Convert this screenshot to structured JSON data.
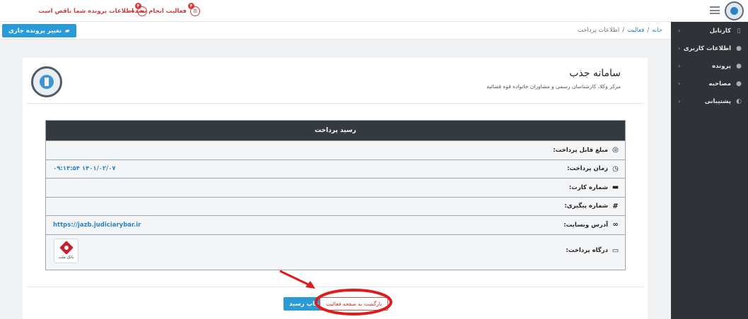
{
  "topbar": {
    "notifications": [
      {
        "label": "فعالیت انجام نشده",
        "badge": "۴",
        "icon": "list-icon"
      },
      {
        "label": "اطلاعات پرونده شما ناقص است",
        "badge": "۴",
        "icon": "folder-icon"
      }
    ],
    "first_notif_prefix": "",
    "brand_icon": "judiciary-emblem-icon"
  },
  "sidebar": {
    "items": [
      {
        "label": "کارتابل",
        "icon": "clipboard-icon"
      },
      {
        "label": "اطلاعات کاربری",
        "icon": "users-icon"
      },
      {
        "label": "پرونده",
        "icon": "user-icon"
      },
      {
        "label": "مصاحبه",
        "icon": "users-icon"
      },
      {
        "label": "پشتیبانی",
        "icon": "headset-icon"
      }
    ]
  },
  "breadcrumb": {
    "home": "خانه",
    "activity": "فعالیت",
    "current": "اطلاعات پرداخت",
    "sep": "/"
  },
  "actions": {
    "change_case": "تغییر پرونده جاری",
    "print_receipt": "چاپ رسید",
    "back_to_activity": "بازگشت به صفحه فعالیت"
  },
  "header": {
    "title": "سامانه جذب",
    "subtitle": "مرکز وکلا، کارشناسان رسمی و مشاوران خانواده قوه قضائیه"
  },
  "receipt": {
    "title": "رسید پرداخت",
    "rows": [
      {
        "label": "مبلغ قابل پرداخت:",
        "value": "",
        "icon": "check-circle-icon"
      },
      {
        "label": "زمان پرداخت:",
        "value": "۰۹:۱۴:۵۴ ۱۴۰۱/۰۲/۰۷",
        "icon": "clock-icon"
      },
      {
        "label": "شماره کارت:",
        "value": "",
        "icon": "credit-card-icon"
      },
      {
        "label": "شماره پیگیری:",
        "value": "",
        "icon": "hash-icon"
      },
      {
        "label": "آدرس وبسایت:",
        "value": "https://jazb.judiciarybar.ir",
        "icon": "link-icon"
      },
      {
        "label": "درگاه پرداخت:",
        "value": "",
        "icon": "monitor-icon"
      }
    ],
    "bank_name": "بانک ملت",
    "bank_sub": "bank mellat"
  },
  "colors": {
    "accent": "#2a9bd6",
    "danger": "#d43a3a",
    "sidebar": "#2f3338",
    "receipt_header": "#343a40"
  }
}
